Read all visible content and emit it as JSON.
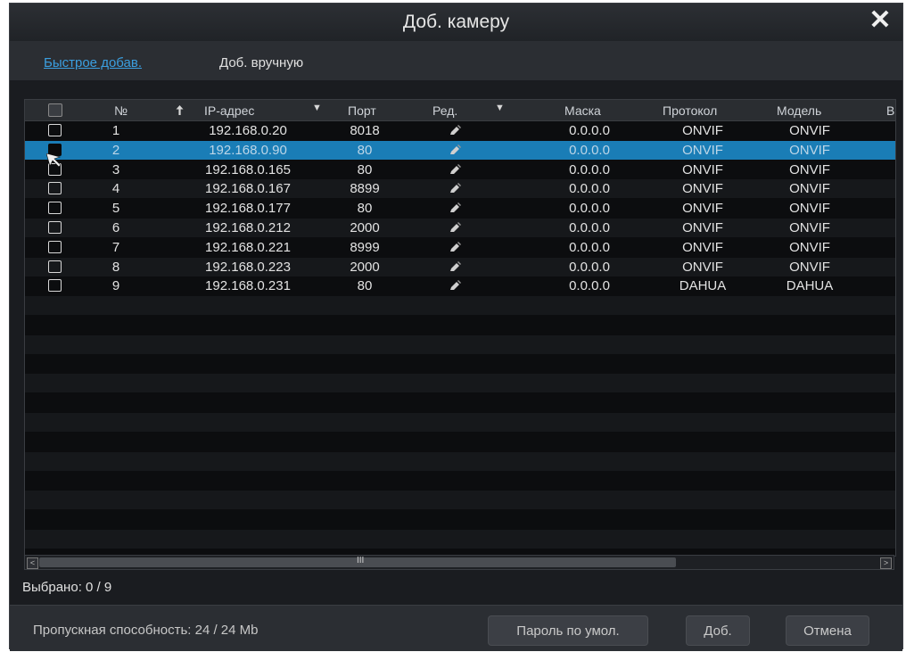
{
  "dialog": {
    "title": "Доб. камеру",
    "close_glyph": "✕"
  },
  "tabs": [
    {
      "label": "Быстрое добав.",
      "active": true
    },
    {
      "label": "Доб. вручную",
      "active": false
    }
  ],
  "table": {
    "columns": [
      "№",
      "IP-адрес",
      "Порт",
      "Ред.",
      "Маска",
      "Протокол",
      "Модель",
      "В"
    ],
    "sort_icon": "arrow-up-icon",
    "rows": [
      {
        "no": "1",
        "ip": "192.168.0.20",
        "port": "8018",
        "mask": "0.0.0.0",
        "protocol": "ONVIF",
        "model": "ONVIF",
        "selected": false
      },
      {
        "no": "2",
        "ip": "192.168.0.90",
        "port": "80",
        "mask": "0.0.0.0",
        "protocol": "ONVIF",
        "model": "ONVIF",
        "selected": true
      },
      {
        "no": "3",
        "ip": "192.168.0.165",
        "port": "80",
        "mask": "0.0.0.0",
        "protocol": "ONVIF",
        "model": "ONVIF",
        "selected": false
      },
      {
        "no": "4",
        "ip": "192.168.0.167",
        "port": "8899",
        "mask": "0.0.0.0",
        "protocol": "ONVIF",
        "model": "ONVIF",
        "selected": false
      },
      {
        "no": "5",
        "ip": "192.168.0.177",
        "port": "80",
        "mask": "0.0.0.0",
        "protocol": "ONVIF",
        "model": "ONVIF",
        "selected": false
      },
      {
        "no": "6",
        "ip": "192.168.0.212",
        "port": "2000",
        "mask": "0.0.0.0",
        "protocol": "ONVIF",
        "model": "ONVIF",
        "selected": false
      },
      {
        "no": "7",
        "ip": "192.168.0.221",
        "port": "8999",
        "mask": "0.0.0.0",
        "protocol": "ONVIF",
        "model": "ONVIF",
        "selected": false
      },
      {
        "no": "8",
        "ip": "192.168.0.223",
        "port": "2000",
        "mask": "0.0.0.0",
        "protocol": "ONVIF",
        "model": "ONVIF",
        "selected": false
      },
      {
        "no": "9",
        "ip": "192.168.0.231",
        "port": "80",
        "mask": "0.0.0.0",
        "protocol": "DAHUA",
        "model": "DAHUA",
        "selected": false
      }
    ]
  },
  "scrollbar": {
    "left_glyph": "<",
    "right_glyph": ">",
    "grip_glyph": "III"
  },
  "status": {
    "selected": "Выбрано: 0 / 9"
  },
  "footer": {
    "bandwidth": "Пропускная способность: 24 / 24 Mb",
    "default_password_label": "Пароль по умол.",
    "add_label": "Доб.",
    "cancel_label": "Отмена"
  },
  "colors": {
    "accent": "#3b9fe0",
    "selection": "#1a7db6",
    "background": "#1a1c20"
  }
}
